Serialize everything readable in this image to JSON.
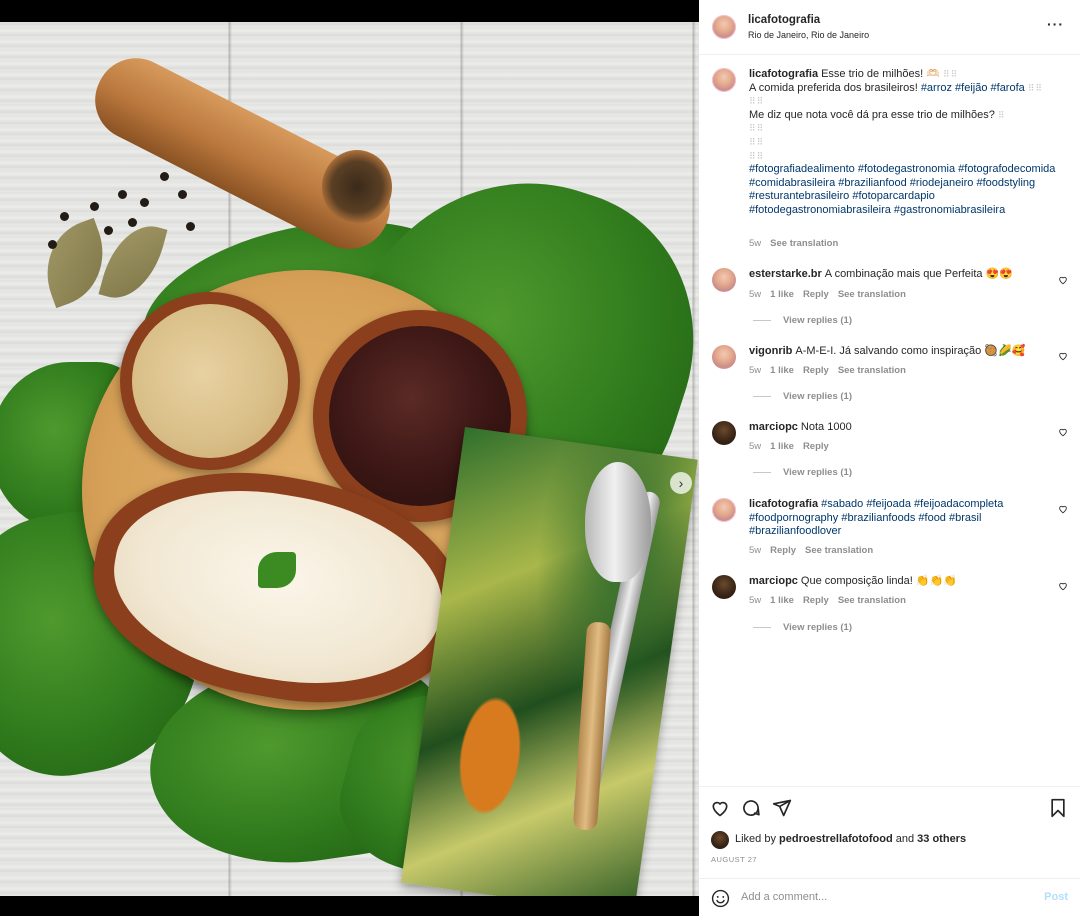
{
  "post": {
    "username": "licafotografia",
    "location": "Rio de Janeiro, Rio de Janeiro",
    "more_icon": "more-horizontal-icon"
  },
  "caption": {
    "username": "licafotografia",
    "line1": "Esse trio de milhões! 🫶🏻",
    "line2_text": "A comida preferida dos brasileiros! ",
    "line2_tags": "#arroz #feijão #farofa",
    "line3": "Me diz que nota você dá pra esse trio de milhões?",
    "hashtags": "#fotografiadealimento #fotodegastronomia #fotografodecomida #comidabrasileira #brazilianfood #riodejaneiro #foodstyling #resturantebrasileiro #fotoparcardapio #fotodegastronomiabrasileira #gastronomiabrasileira",
    "time": "5w",
    "see_translation": "See translation"
  },
  "comments": [
    {
      "username": "esterstarke.br",
      "text": "A combinação mais que Perfeita 😍😍",
      "time": "5w",
      "likes": "1 like",
      "reply": "Reply",
      "see_translation": "See translation",
      "view_replies": "View replies (1)"
    },
    {
      "username": "vigonrib",
      "text": "A-M-E-I. Já salvando como inspiração 🥘🌽🥰",
      "time": "5w",
      "likes": "1 like",
      "reply": "Reply",
      "see_translation": "See translation",
      "view_replies": "View replies (1)"
    },
    {
      "username": "marciopc",
      "text": "Nota 1000",
      "time": "5w",
      "likes": "1 like",
      "reply": "Reply",
      "view_replies": "View replies (1)"
    },
    {
      "username": "licafotografia",
      "text": "#sabado #feijoada #feijoadacompleta #foodpornography #brazilianfoods #food #brasil #brazilianfoodlover",
      "time": "5w",
      "reply": "Reply",
      "see_translation": "See translation"
    },
    {
      "username": "marciopc",
      "text": "Que composição linda! 👏👏👏",
      "time": "5w",
      "likes": "1 like",
      "reply": "Reply",
      "see_translation": "See translation",
      "view_replies": "View replies (1)"
    }
  ],
  "actions": {
    "liked_by_prefix": "Liked by ",
    "liked_by_user": "pedroestrellafotofood",
    "liked_by_and": " and ",
    "liked_by_others": "33 others",
    "date": "AUGUST 27"
  },
  "comment_box": {
    "placeholder": "Add a comment...",
    "post": "Post"
  },
  "colors": {
    "hashtag": "#00376b",
    "muted": "#8e8e8e",
    "post_disabled": "#b2dffc"
  }
}
